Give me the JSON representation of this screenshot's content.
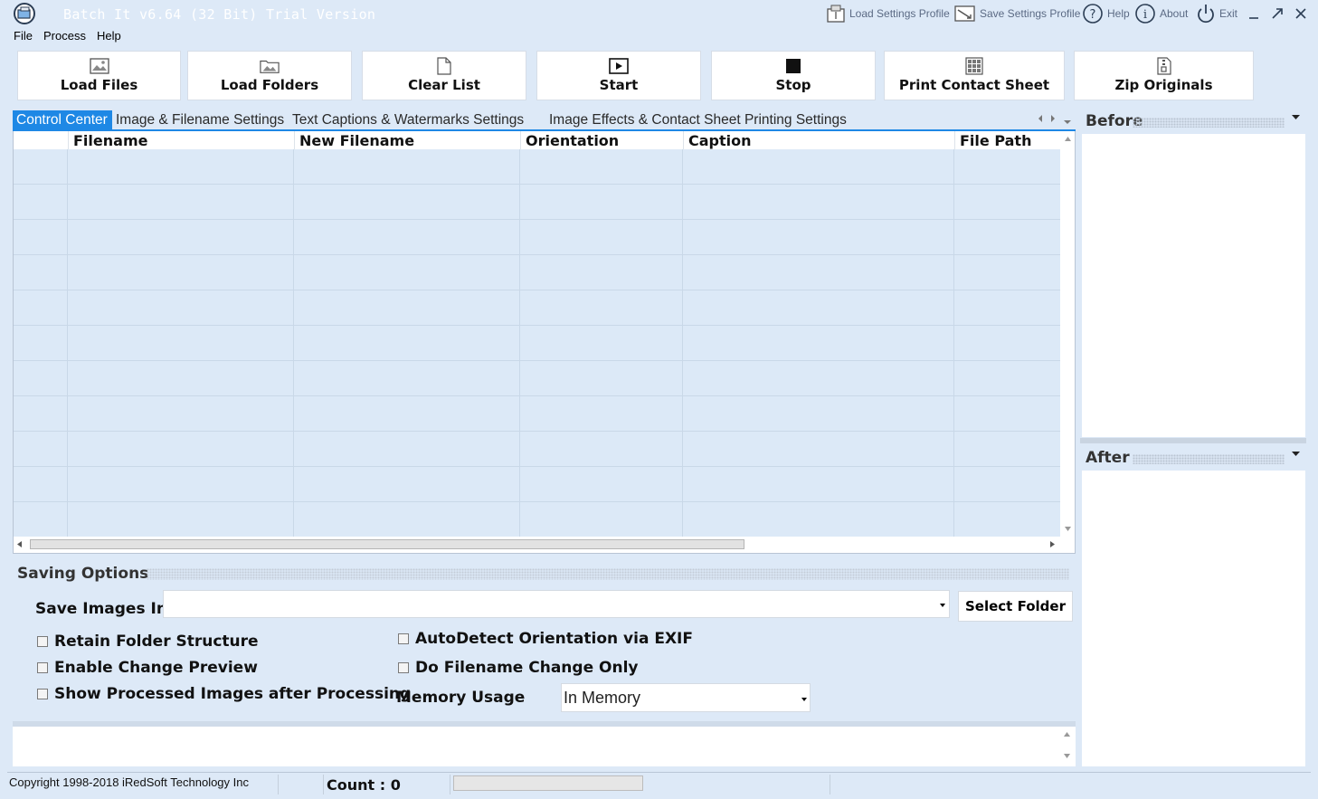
{
  "window": {
    "title": "Batch It v6.64 (32 Bit) Trial Version",
    "actions": [
      {
        "label": "Load Settings Profile",
        "icon": "load-profile-icon"
      },
      {
        "label": "Save Settings Profile",
        "icon": "save-profile-icon"
      },
      {
        "label": "Help",
        "icon": "help-icon"
      },
      {
        "label": "About",
        "icon": "info-icon"
      },
      {
        "label": "Exit",
        "icon": "power-icon"
      }
    ]
  },
  "menu": [
    "File",
    "Process",
    "Help"
  ],
  "toolbar": [
    {
      "label": "Load Files",
      "icon": "image-icon"
    },
    {
      "label": "Load Folders",
      "icon": "folder-image-icon"
    },
    {
      "label": "Clear List",
      "icon": "blank-page-icon"
    },
    {
      "label": "Start",
      "icon": "play-icon"
    },
    {
      "label": "Stop",
      "icon": "stop-icon"
    },
    {
      "label": "Print Contact Sheet",
      "icon": "contact-sheet-icon"
    },
    {
      "label": "Zip Originals",
      "icon": "zip-icon"
    }
  ],
  "tabs": [
    "Control Center",
    "Image & Filename Settings",
    "Text Captions & Watermarks Settings",
    "Image Effects & Contact Sheet Printing Settings"
  ],
  "active_tab": "Control Center",
  "grid": {
    "columns": [
      "Filename",
      "New Filename",
      "Orientation",
      "Caption",
      "File Path"
    ],
    "rows": []
  },
  "panels": {
    "before": "Before",
    "after": "After"
  },
  "saving": {
    "title": "Saving Options",
    "save_label": "Save Images In",
    "save_value": "",
    "select_folder": "Select Folder",
    "options_left": [
      "Retain Folder Structure",
      "Enable Change Preview",
      "Show Processed Images after Processing"
    ],
    "options_right": [
      "AutoDetect Orientation via EXIF",
      "Do Filename Change Only"
    ],
    "memory_label": "Memory Usage",
    "memory_value": "In Memory"
  },
  "status": {
    "copyright": "Copyright 1998-2018 iRedSoft Technology Inc",
    "count": "Count : 0"
  },
  "colors": {
    "accent": "#1e88e5",
    "background": "#dde9f7",
    "grid_row": "#dce9f7"
  }
}
